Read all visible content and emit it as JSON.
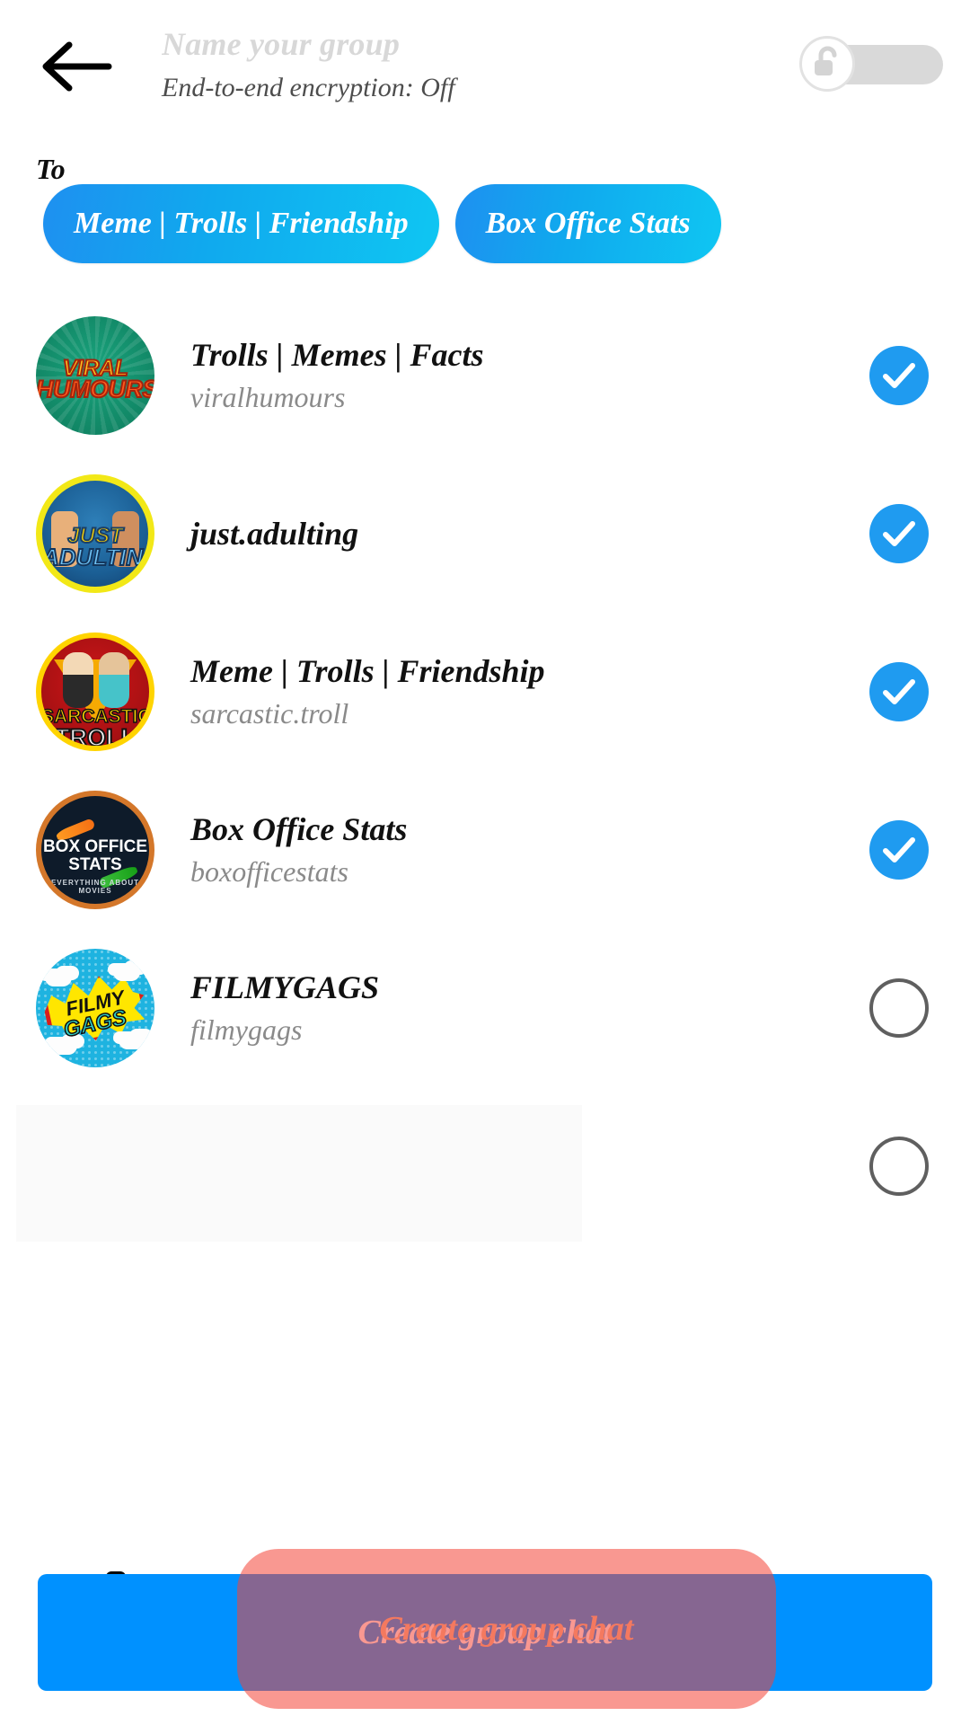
{
  "header": {
    "back_icon": "arrow-left-icon",
    "group_name_placeholder": "Name your group",
    "group_name_value": "",
    "encryption_status": "End-to-end encryption: Off",
    "lock_toggle": {
      "icon": "unlocked-padlock-icon",
      "state": "off",
      "track_color": "#d9d9d9",
      "knob_color": "#ffffff"
    }
  },
  "recipients": {
    "label": "To",
    "chip_gradient_start": "#1e90f0",
    "chip_gradient_end": "#0fc6f2",
    "chips": [
      {
        "label": "Meme | Trolls | Friendship"
      },
      {
        "label": "Box Office Stats"
      }
    ]
  },
  "contacts": {
    "selected_color": "#1f9bf0",
    "unselected_border_color": "#5f5f5f",
    "items": [
      {
        "name": "Trolls | Memes | Facts",
        "username": "viralhumours",
        "selected": true,
        "avatar": {
          "style": "viral",
          "line1": "VIRAL",
          "line2": "HUMOURS",
          "bg_color": "#128a68"
        }
      },
      {
        "name": "just.adulting",
        "username": "",
        "selected": true,
        "avatar": {
          "style": "adulting",
          "line1": "JUST",
          "line2": "ADULTING",
          "bg_color": "#1b5f95"
        }
      },
      {
        "name": "Meme | Trolls | Friendship",
        "username": "sarcastic.troll",
        "selected": true,
        "avatar": {
          "style": "troll",
          "line1": "SARCASTIC",
          "line2": "TROLL",
          "bg_color": "#a61013"
        }
      },
      {
        "name": "Box Office Stats",
        "username": "boxofficestats",
        "selected": true,
        "avatar": {
          "style": "boxoffice",
          "line1": "BOX OFFICE",
          "line2": "STATS",
          "line3": "EVERYTHING ABOUT MOVIES",
          "bg_color": "#0e1b2a"
        }
      },
      {
        "name": "FILMYGAGS",
        "username": "filmygags",
        "selected": false,
        "avatar": {
          "style": "filmy",
          "line1": "FILMY",
          "line2": "GAGS",
          "bg_color": "#1eb3e0"
        }
      },
      {
        "name": "",
        "username": "",
        "selected": false,
        "avatar": {
          "style": "placeholder",
          "line1": "",
          "line2": "",
          "bg_color": "#fafafa"
        }
      }
    ]
  },
  "footer": {
    "create_button_label": "Create group chat",
    "create_button_color": "#0091ff",
    "tap_highlight_color": "#f44336",
    "tap_label": "Create group chat"
  }
}
